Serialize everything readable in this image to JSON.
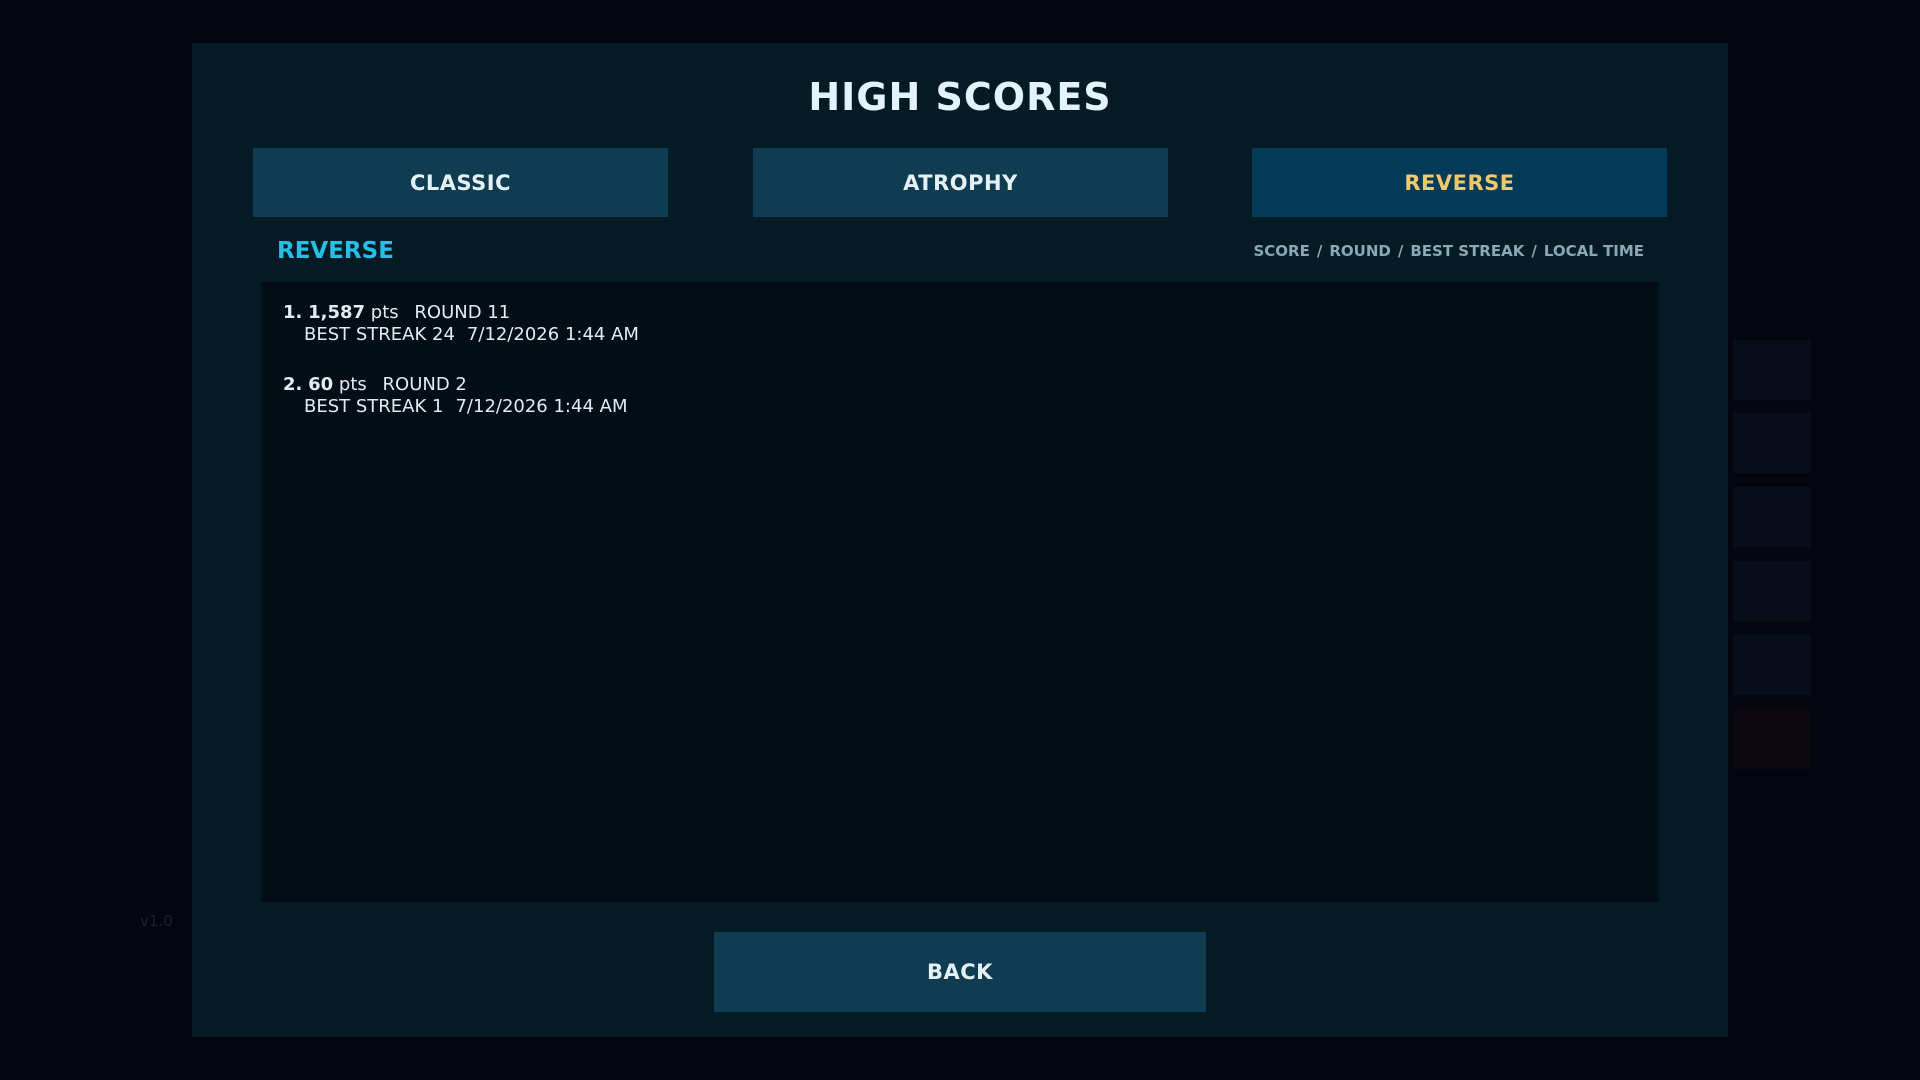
{
  "version": "v1.0",
  "panel": {
    "title": "HIGH SCORES"
  },
  "tabs": [
    {
      "label": "CLASSIC",
      "active": false
    },
    {
      "label": "ATROPHY",
      "active": false
    },
    {
      "label": "REVERSE",
      "active": true
    }
  ],
  "mode_label": "REVERSE",
  "columns": [
    "SCORE",
    "ROUND",
    "BEST STREAK",
    "LOCAL TIME"
  ],
  "column_separator": "/",
  "scores": [
    {
      "rank": "1.",
      "points": "1,587",
      "pts_unit": "pts",
      "round": "ROUND 11",
      "best_streak": "BEST STREAK 24",
      "local_time": "7/12/2026 1:44 AM"
    },
    {
      "rank": "2.",
      "points": "60",
      "pts_unit": "pts",
      "round": "ROUND 2",
      "best_streak": "BEST STREAK 1",
      "local_time": "7/12/2026 1:44 AM"
    }
  ],
  "back_button": "BACK",
  "colors": {
    "background": "#03050f",
    "panel": "#041a25",
    "tab": "#0f3c51",
    "tab_active": "#023a58",
    "tab_active_text": "#f1c86a",
    "mode_label": "#26bfe6",
    "list_bg": "#010e15"
  }
}
